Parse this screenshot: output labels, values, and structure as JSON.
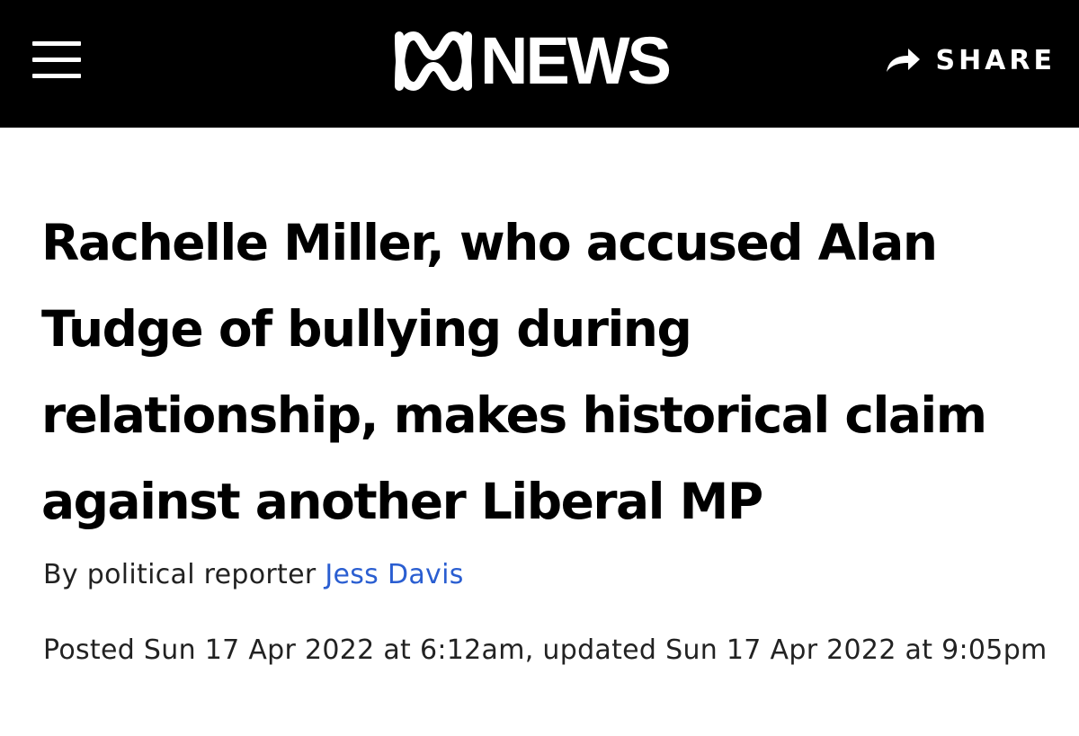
{
  "header": {
    "menu_icon": "hamburger-menu-icon",
    "logo_text": "NEWS",
    "logo_icon": "abc-lissajous-logo",
    "share_icon": "share-arrow-icon",
    "share_label": "SHARE",
    "background_color": "#000000",
    "text_color": "#ffffff"
  },
  "article": {
    "headline": "Rachelle Miller, who accused Alan Tudge of bullying during relationship, makes historical claim against another Liberal MP",
    "byline_prefix": "By political reporter ",
    "author": "Jess Davis",
    "author_link_color": "#2a5ed1",
    "posted_label": "Posted",
    "posted_date": "Sun 17 Apr 2022 at 6:12am",
    "updated_label": "updated",
    "updated_date": "Sun 17 Apr 2022 at 9:05pm"
  }
}
